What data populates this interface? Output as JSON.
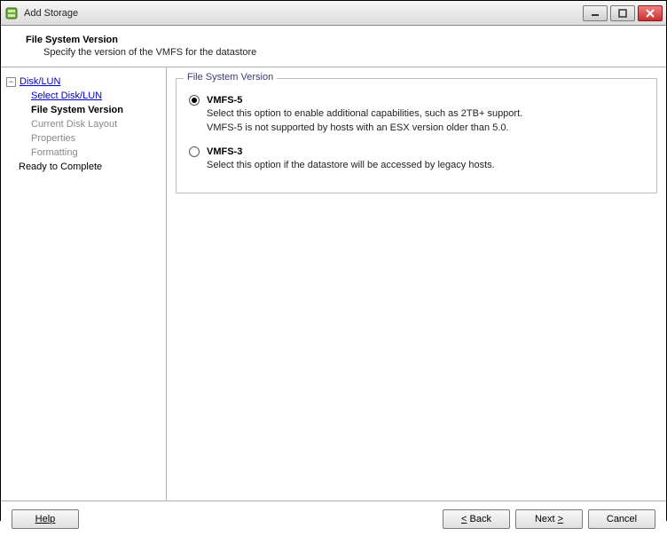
{
  "titlebar": {
    "title": "Add Storage"
  },
  "header": {
    "title": "File System Version",
    "subtitle": "Specify the version of the VMFS for the datastore"
  },
  "sidebar": {
    "root": "Disk/LUN",
    "items": [
      {
        "label": "Select Disk/LUN",
        "type": "link"
      },
      {
        "label": "File System Version",
        "type": "current"
      },
      {
        "label": "Current Disk Layout",
        "type": "gray"
      },
      {
        "label": "Properties",
        "type": "gray"
      },
      {
        "label": "Formatting",
        "type": "gray"
      }
    ],
    "trailing": "Ready to Complete",
    "toggle": "−"
  },
  "fieldset": {
    "legend": "File System Version",
    "options": [
      {
        "label": "VMFS-5",
        "selected": true,
        "desc1": "Select this option to enable additional capabilities, such as 2TB+ support.",
        "desc2": "VMFS-5 is not supported by hosts with an ESX version older than 5.0."
      },
      {
        "label": "VMFS-3",
        "selected": false,
        "desc1": "Select this option if the datastore will be accessed by legacy hosts.",
        "desc2": ""
      }
    ]
  },
  "footer": {
    "help": "Help",
    "back": "Back",
    "next": "Next",
    "cancel": "Cancel"
  }
}
